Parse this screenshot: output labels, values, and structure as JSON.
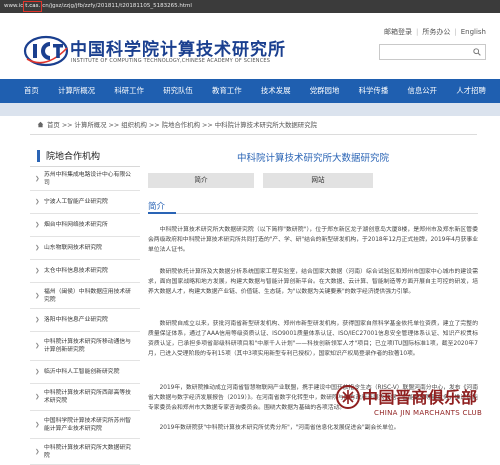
{
  "browser": {
    "url_prefix": "www.ic",
    "url_highlight": "t.cas.",
    "url_suffix": "cn/jgsz/zzjg/jfb/zzfy/201811/t20181105_5183265.html"
  },
  "header": {
    "logo_cn": "中国科学院计算技术研究所",
    "logo_en": "INSTITUTE OF COMPUTING TECHNOLOGY,CHINESE ACADEMY OF SCIENCES",
    "links": [
      "邮箱登录",
      "所务办公",
      "English"
    ],
    "search_placeholder": ""
  },
  "nav": {
    "items": [
      "首页",
      "计算所概况",
      "科研工作",
      "研究队伍",
      "教育工作",
      "技术发展",
      "党群园地",
      "科学传播",
      "信息公开",
      "人才招聘"
    ]
  },
  "breadcrumb": "首页 >> 计算所概况 >> 组织机构 >> 院地合作机构 >> 中科院计算技术研究所大数据研究院",
  "sidebar": {
    "title": "院地合作机构",
    "items": [
      "苏州中科集成电路设计中心有限公司",
      "宁波人工智能产业研究院",
      "烟台中科网络技术研究所",
      "山东物联网技术研究院",
      "太仓中科信息技术研究院",
      "福州（闽侯）中科数据应用技术研究院",
      "洛阳中科信息产业研究院",
      "中科院计算技术研究所移动通信与计算创新研究院",
      "临沂中科人工智能创新研究院",
      "中科院计算技术研究所西部高等技术研究院",
      "中国科学院计算技术研究所苏州智能计算产业技术研究院",
      "中科院计算技术研究所大数据研究院"
    ]
  },
  "main": {
    "title": "中科院计算技术研究所大数据研究院",
    "tabs": [
      "简介",
      "网站"
    ],
    "section_title": "简介",
    "paragraphs": [
      "中科院计算技术研究所大数据研究院（以下简称\"数研院\"），位于郑东新区龙子湖创意岛大厦8楼，是郑州市及郑东新区管委会两级政府和中科院计算技术研究所共同打造的\"产、学、研\"结合的新型研发机构，于2018年12月正式挂牌，2019年4月获事业单位法人证书。",
      "数研院依托计算所及大数据分析系统国家工程实验室，结合国家大数据（河南）综合试验区和郑州市国家中心城市的建设需求，面向国家战略和地方发展，构建大数据与智能计算创新平台。在大数据、云计算、智能制造等方面开展自主可控的研发，培养大数据人才，构建大数据产业链、价值链、生态链，为\"以数据为关键要素\"的数字经济提供强力引擎。",
      "数研院自成立以来，获批河南省新型研发机构、郑州市新型研发机构，获得国家自然科学基金依托单位资质，建立了完整的质量保证体系，通过了AAA信用等级资质认证、ISO9001质量体系认证、ISO/IEC27001信息安全管理体系认证、知识产权贯标资质认证，已承担多项省部级科研项目和\"中原千人计划\"——科技创新领军人才\"项目；已立项ITU国际标准1项，截至2020年7月，已进入受理阶段的专利15项（其中3项实用新型专利已授权），国家知识产权局登录作者的软著10项。",
      "2019年，数研院推动成立河南省智慧物联网产业联盟，携手建设中国开放指令生态（RISC-V）联盟河南分中心，发布《河南省大数据与数字经济发展报告（2019）》。在河南省数字化转型中，数研院与地方政府开展大数据、智能制造等新业务，推进智能专家委员会和郑州市大数据专家咨询委员会。围绕大数据为基础的各项活动。",
      "2019年数研院获\"中科院计算技术研究所优秀分所\"，\"河南省信息化发展促进会\"副会长单位。"
    ]
  },
  "watermark": {
    "cn": "中国晋商俱乐部",
    "en": "CHINA JIN MARCHANTS CLUB"
  },
  "colors": {
    "brand_blue": "#1f5fb0",
    "link_blue": "#2a64b5",
    "watermark_red": "#8f1f1f"
  }
}
